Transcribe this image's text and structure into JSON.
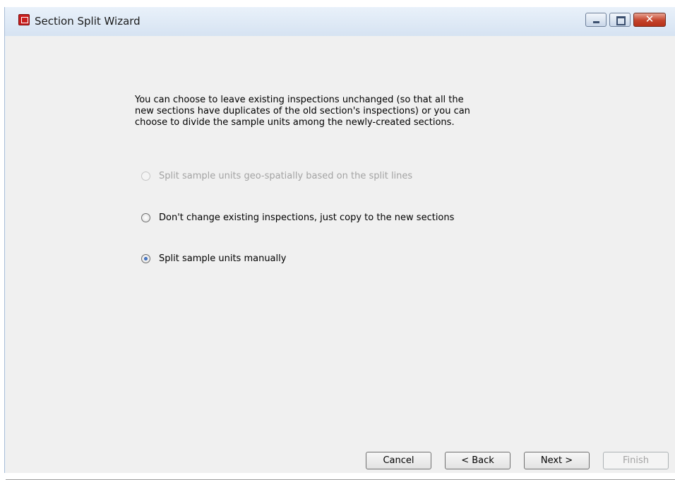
{
  "window": {
    "title": "Section Split Wizard"
  },
  "intro_text": "You can choose to leave existing inspections unchanged (so that all the\nnew sections have duplicates of the old section's inspections) or you can\nchoose to divide the sample units among the newly-created sections.",
  "options": [
    {
      "label": "Split sample units geo-spatially based on the split lines",
      "selected": false,
      "enabled": false
    },
    {
      "label": "Don't change existing inspections, just copy to the new sections",
      "selected": false,
      "enabled": true
    },
    {
      "label": "Split sample units manually",
      "selected": true,
      "enabled": true
    }
  ],
  "buttons": {
    "cancel": "Cancel",
    "back": "< Back",
    "next": "Next >",
    "finish": "Finish"
  },
  "caption_buttons": {
    "close_glyph": "✕"
  }
}
